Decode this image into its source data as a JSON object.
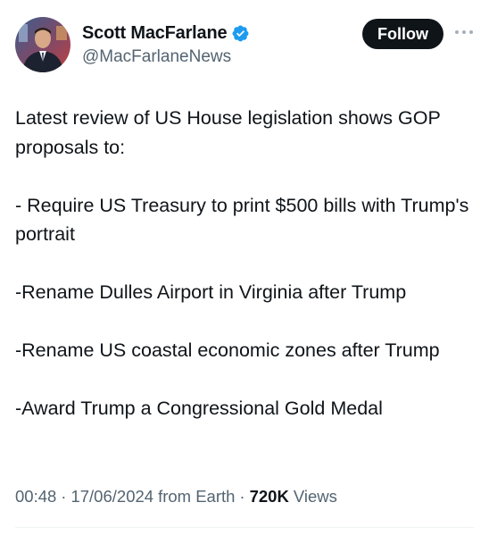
{
  "author": {
    "name": "Scott MacFarlane",
    "handle": "@MacFarlaneNews",
    "verified": true,
    "verified_color": "#1d9bf0"
  },
  "actions": {
    "follow_label": "Follow",
    "more_icon": "more-horizontal-icon"
  },
  "tweet": {
    "intro": "Latest review of US House legislation shows GOP proposals to:",
    "items": [
      "- Require US Treasury to print $500 bills with Trump's portrait",
      "-Rename Dulles Airport in Virginia after Trump",
      "-Rename US coastal economic zones after Trump",
      "-Award Trump a Congressional Gold Medal"
    ]
  },
  "meta": {
    "time": "00:48",
    "separator": "·",
    "date": "17/06/2024",
    "source": "from Earth",
    "views_count": "720K",
    "views_label": "Views"
  },
  "colors": {
    "text": "#0f1419",
    "secondary": "#536471",
    "button_bg": "#0f1419",
    "button_text": "#ffffff",
    "divider": "#eff3f4"
  }
}
